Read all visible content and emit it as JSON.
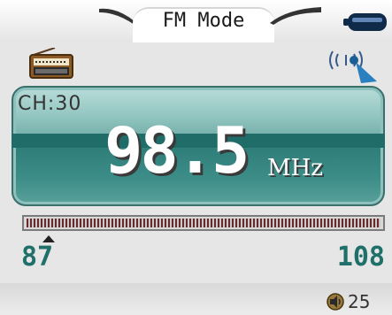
{
  "header": {
    "title": "FM Mode",
    "battery_icon": "battery-icon"
  },
  "status": {
    "radio_icon": "radio-icon",
    "signal_icon": "signal-icon"
  },
  "station": {
    "channel": "CH:30",
    "frequency": "98.5",
    "unit": "MHz"
  },
  "tuner": {
    "min_label": "87",
    "max_label": "108",
    "min_value": 87,
    "max_value": 108,
    "current_value": 87
  },
  "footer": {
    "volume_icon": "volume-icon",
    "volume_level": "25"
  },
  "colors": {
    "accent": "#1f6f6a",
    "panel": "#3d8d88"
  }
}
